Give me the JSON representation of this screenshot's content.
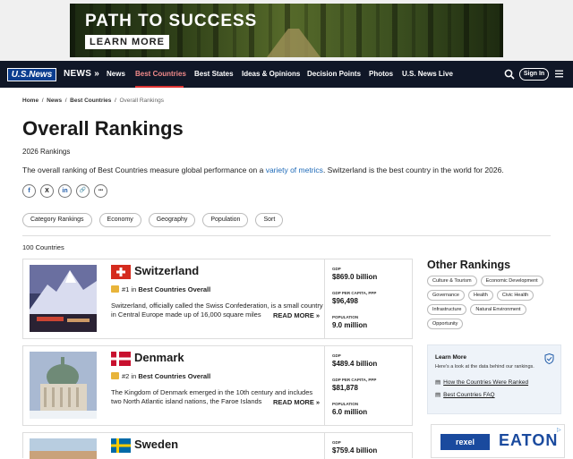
{
  "ad": {
    "headline": "PATH TO SUCCESS",
    "cta": "LEARN MORE"
  },
  "nav": {
    "logo": "U.S.News",
    "section": "NEWS »",
    "items": [
      "News",
      "Best Countries",
      "Best States",
      "Ideas & Opinions",
      "Decision Points",
      "Photos",
      "U.S. News Live"
    ],
    "active": "Best Countries",
    "signin": "Sign In",
    "accent": "#d33333"
  },
  "breadcrumb": [
    "Home",
    "/",
    "News",
    "/",
    "Best Countries",
    "/",
    "Overall Rankings"
  ],
  "page": {
    "title": "Overall Rankings",
    "subtitle": "2026 Rankings",
    "desc_pre": "The overall ranking of Best Countries measure global performance on a ",
    "desc_link": "variety of metrics",
    "desc_post": ". Switzerland is the best country in the world for 2026.",
    "count": "100 Countries"
  },
  "share": [
    "f",
    "X",
    "in",
    "🔗",
    "•••"
  ],
  "filters": [
    "Category Rankings",
    "Economy",
    "Geography",
    "Population",
    "Sort"
  ],
  "countries": [
    {
      "name": "Switzerland",
      "rank": "#1",
      "rank_text": " in ",
      "category": "Best Countries Overall",
      "blurb": "Switzerland, officially called the Swiss Confederation, is a small country in Central Europe made up of 16,000 square miles",
      "more": "READ MORE »",
      "gdp_label": "GDP",
      "gdp": "$869.0 billion",
      "pc_label": "GDP PER CAPITA, PPP",
      "pc": "$96,498",
      "pop_label": "POPULATION",
      "pop": "9.0 million"
    },
    {
      "name": "Denmark",
      "rank": "#2",
      "rank_text": " in ",
      "category": "Best Countries Overall",
      "blurb": "The Kingdom of Denmark emerged in the 10th century and includes two North Atlantic island nations, the Faroe Islands",
      "more": "READ MORE »",
      "gdp_label": "GDP",
      "gdp": "$489.4 billion",
      "pc_label": "GDP PER CAPITA, PPP",
      "pc": "$81,878",
      "pop_label": "POPULATION",
      "pop": "6.0 million"
    },
    {
      "name": "Sweden",
      "gdp_label": "GDP",
      "gdp": "$759.4 billion"
    }
  ],
  "sidebar": {
    "heading": "Other Rankings",
    "tags": [
      "Culture & Tourism",
      "Economic Development",
      "Governance",
      "Health",
      "Civic Health",
      "Infrastructure",
      "Natural Environment",
      "Opportunity"
    ],
    "learn_title": "Learn More",
    "learn_desc": "Here's a look at the data behind our rankings.",
    "learn_links": [
      "How the Countries Were Ranked",
      "Best Countries FAQ"
    ]
  },
  "ad2": {
    "brand1": "rexel",
    "brand2": "EATON"
  }
}
